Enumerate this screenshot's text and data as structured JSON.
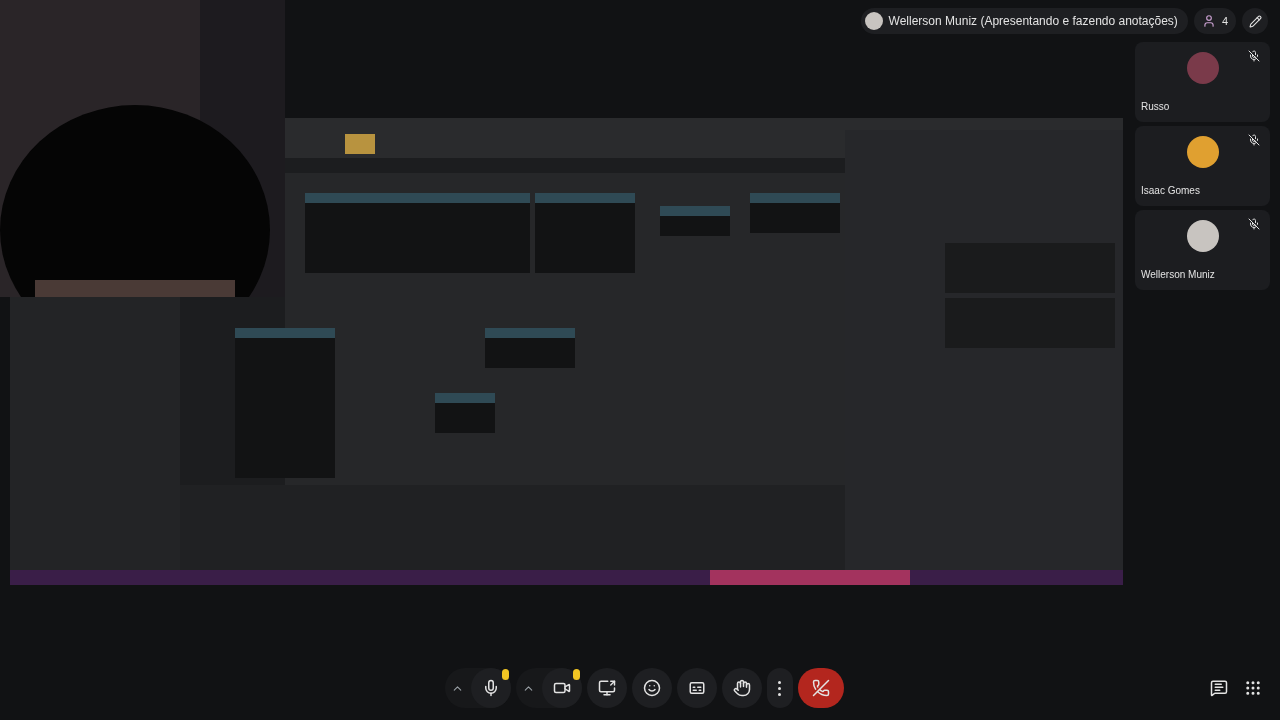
{
  "presenter": {
    "label": "Wellerson Muniz (Apresentando e fazendo anotações)"
  },
  "participants_button": {
    "count": "4"
  },
  "participants": [
    {
      "name": "Russo",
      "muted": true,
      "color": "#7a3a4a"
    },
    {
      "name": "Isaac Gomes",
      "muted": true,
      "color": "#e0a030"
    },
    {
      "name": "Wellerson Muniz",
      "muted": true,
      "color": "#c8c4c0"
    }
  ],
  "controls": [
    {
      "kind": "mic",
      "alert": true
    },
    {
      "kind": "camera",
      "alert": true
    },
    {
      "kind": "present"
    },
    {
      "kind": "emoji"
    },
    {
      "kind": "captions"
    },
    {
      "kind": "hand"
    },
    {
      "kind": "more"
    },
    {
      "kind": "leave"
    }
  ],
  "side_controls": [
    {
      "kind": "chat"
    },
    {
      "kind": "apps"
    }
  ]
}
